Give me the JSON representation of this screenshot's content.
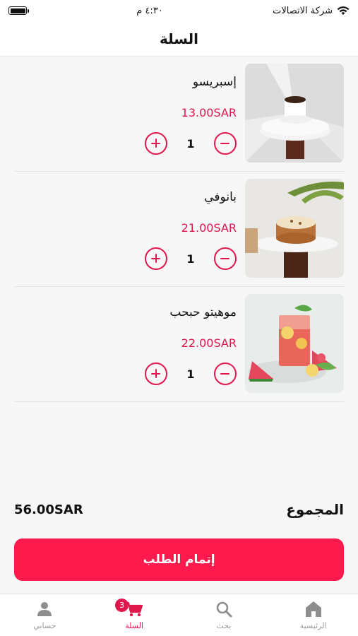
{
  "status_bar": {
    "carrier": "شركة الاتصالات",
    "time": "٤:٣٠ م"
  },
  "header": {
    "title": "السلة"
  },
  "cart": {
    "items": [
      {
        "name": "إسبريسو",
        "price": "13.00SAR",
        "quantity": "1",
        "image": "espresso-cup-photo"
      },
      {
        "name": "بانوفي",
        "price": "21.00SAR",
        "quantity": "1",
        "image": "banoffee-cake-photo"
      },
      {
        "name": "موهيتو حبحب",
        "price": "22.00SAR",
        "quantity": "1",
        "image": "watermelon-mojito-photo"
      }
    ]
  },
  "summary": {
    "total_label": "المجموع",
    "total_amount": "56.00SAR"
  },
  "checkout": {
    "label": "إتمام الطلب"
  },
  "nav": {
    "items": [
      {
        "label": "حسابي",
        "icon": "user-icon"
      },
      {
        "label": "السلة",
        "icon": "cart-icon",
        "badge": "3",
        "active": true
      },
      {
        "label": "بحث",
        "icon": "search-icon"
      },
      {
        "label": "الرئيسية",
        "icon": "home-icon"
      }
    ]
  },
  "colors": {
    "accent": "#e0174d",
    "button": "#ff1a4d"
  }
}
